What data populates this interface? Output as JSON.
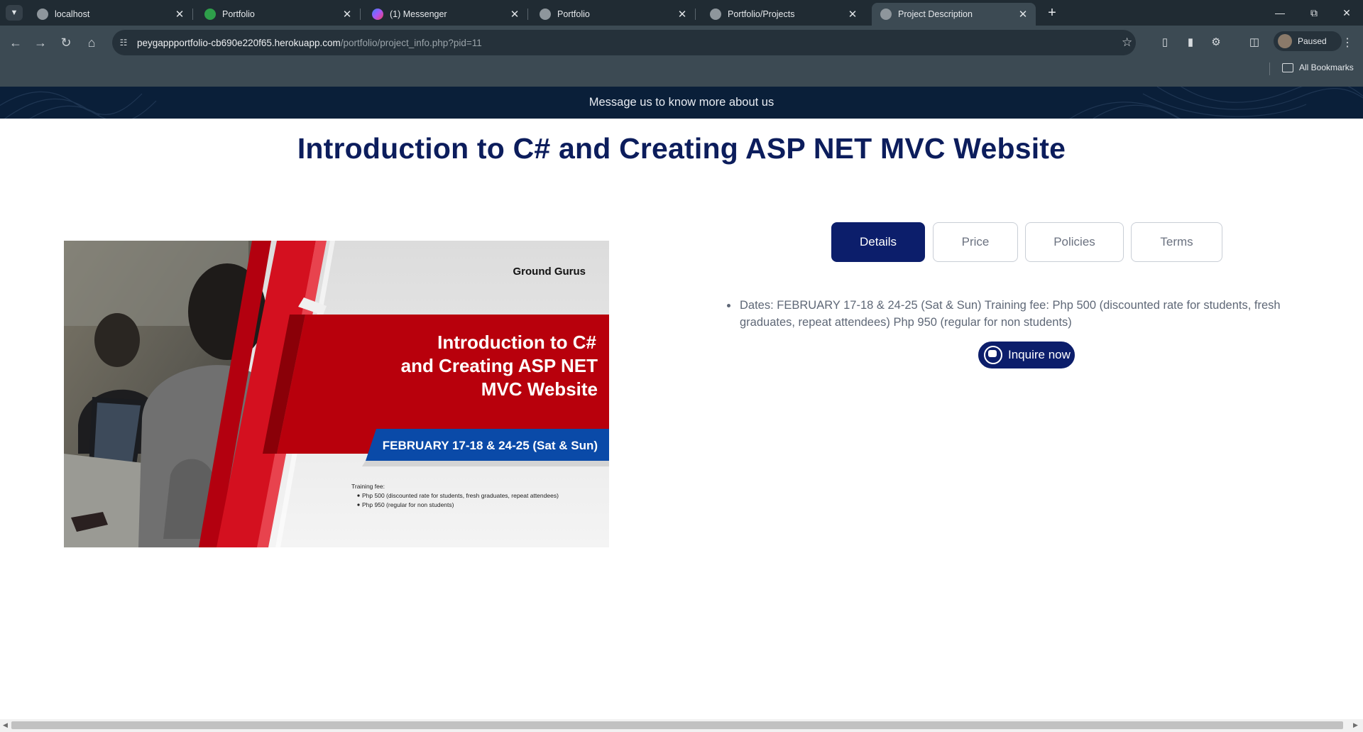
{
  "browser": {
    "tabs": [
      {
        "title": "localhost",
        "favicon_color": "#8e969c"
      },
      {
        "title": "Portfolio",
        "favicon_color": "#2e9f4a"
      },
      {
        "title": "(1) Messenger",
        "favicon_color": "#a855f7"
      },
      {
        "title": "Portfolio",
        "favicon_color": "#8e969c"
      },
      {
        "title": "Portfolio/Projects",
        "favicon_color": "#8e969c"
      },
      {
        "title": "Project Description",
        "favicon_color": "#8e969c"
      }
    ],
    "active_tab_index": 5,
    "url_host": "peygappportfolio-cb690e220f65.herokuapp.com",
    "url_path": "/portfolio/project_info.php?pid=11",
    "profile_label": "Paused",
    "bookmarks_label": "All Bookmarks"
  },
  "banner": {
    "text": "Message us to know more about us",
    "color": "#0a1f39"
  },
  "page": {
    "title": "Introduction to C# and Creating ASP NET MVC Website",
    "title_color": "#0c1d5c"
  },
  "hero_image": {
    "brand": "Ground Gurus",
    "headline_lines": [
      "Introduction to C#",
      "and Creating ASP NET",
      "MVC Website"
    ],
    "dates": "FEBRUARY 17-18 & 24-25 (Sat & Sun)",
    "fee_label": "Training fee:",
    "fee_items": [
      "Php 500 (discounted rate for students, fresh graduates, repeat attendees)",
      "Php 950 (regular for non students)"
    ]
  },
  "info_tabs": {
    "items": [
      "Details",
      "Price",
      "Policies",
      "Terms"
    ],
    "active": "Details",
    "accent": "#0c1e6b"
  },
  "details": {
    "text": "Dates: FEBRUARY 17-18 & 24-25 (Sat & Sun) Training fee: Php 500 (discounted rate for students, fresh graduates, repeat attendees) Php 950 (regular for non students)"
  },
  "cta": {
    "label": "Inquire now",
    "icon": "chat-icon"
  }
}
